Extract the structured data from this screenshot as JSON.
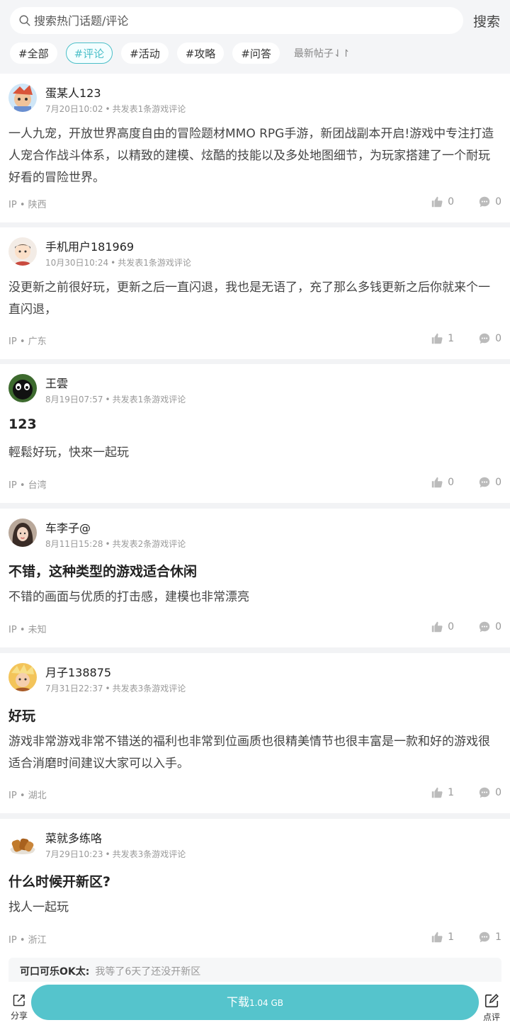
{
  "search": {
    "placeholder": "搜索热门话题/评论",
    "button": "搜索"
  },
  "tags": [
    "#全部",
    "#评论",
    "#活动",
    "#攻略",
    "#问答"
  ],
  "sort_label": "最新帖子⇃↾",
  "posts": [
    {
      "user": "蛋某人123",
      "date": "7月20日10:02",
      "count": "共发表1条游戏评论",
      "title": "",
      "body": "一人九宠，开放世界高度自由的冒险题材MMO RPG手游，新团战副本开启!游戏中专注打造人宠合作战斗体系，以精致的建模、炫酷的技能以及多处地图细节，为玩家搭建了一个耐玩好看的冒险世界。",
      "ip": "陕西",
      "likes": "0",
      "comments": "0"
    },
    {
      "user": "手机用户181969",
      "date": "10月30日10:24",
      "count": "共发表1条游戏评论",
      "title": "",
      "body": "没更新之前很好玩，更新之后一直闪退，我也是无语了，充了那么多钱更新之后你就来个一直闪退，",
      "ip": "广东",
      "likes": "1",
      "comments": "0"
    },
    {
      "user": "王雲",
      "date": "8月19日07:57",
      "count": "共发表1条游戏评论",
      "title": "123",
      "body": "輕鬆好玩，快來一起玩",
      "ip": "台湾",
      "likes": "0",
      "comments": "0"
    },
    {
      "user": "车李子@",
      "date": "8月11日15:28",
      "count": "共发表2条游戏评论",
      "title": "不错，这种类型的游戏适合休闲",
      "body": "不错的画面与优质的打击感，建模也非常漂亮",
      "ip": "未知",
      "likes": "0",
      "comments": "0"
    },
    {
      "user": "月子138875",
      "date": "7月31日22:37",
      "count": "共发表3条游戏评论",
      "title": "好玩",
      "body": "游戏非常游戏非常不错送的福利也非常到位画质也很精美情节也很丰富是一款和好的游戏很适合消磨时间建议大家可以入手。",
      "ip": "湖北",
      "likes": "1",
      "comments": "0"
    },
    {
      "user": "菜就多练咯",
      "date": "7月29日10:23",
      "count": "共发表3条游戏评论",
      "title": "什么时候开新区?",
      "body": "找人一起玩",
      "ip": "浙江",
      "likes": "1",
      "comments": "1"
    }
  ],
  "ip_prefix": "IP",
  "reply": {
    "user": "可口可乐OK太:",
    "text": "我等了6天了还没开新区"
  },
  "bottom": {
    "share": "分享",
    "download": "下载",
    "size": "1.04 GB",
    "rate": "点评"
  },
  "colors": {
    "accent": "#55c4cc",
    "tag_active": "#4bbfc8"
  }
}
